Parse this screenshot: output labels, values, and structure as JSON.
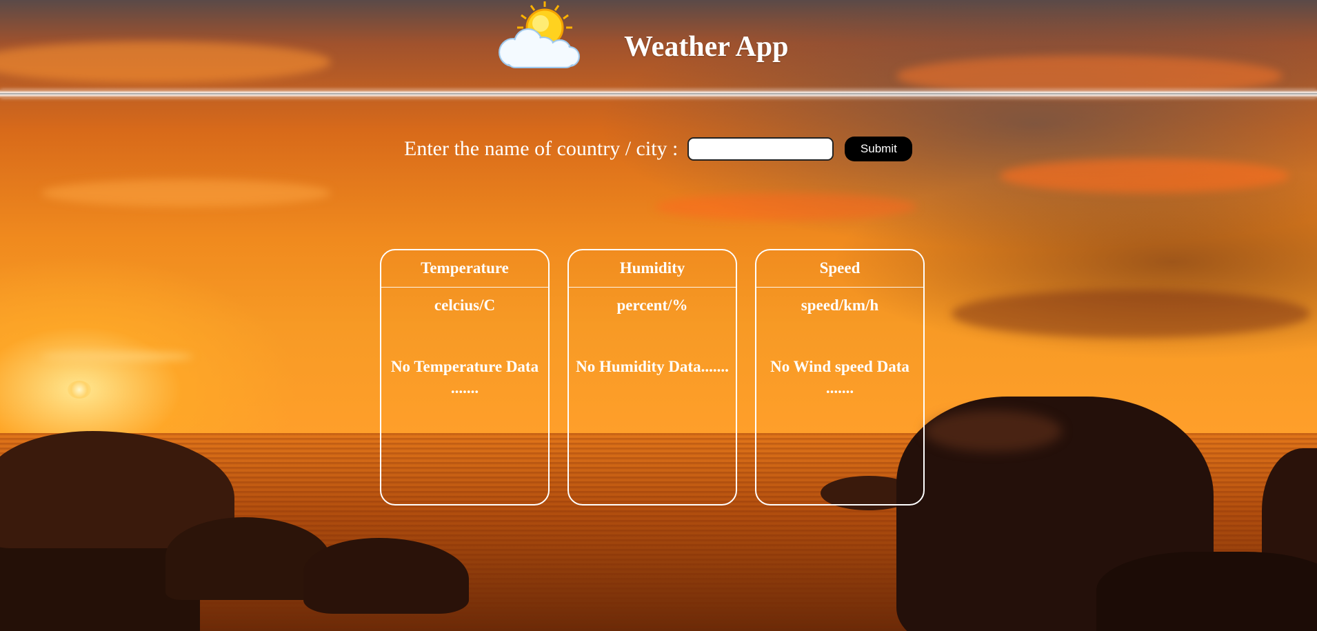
{
  "header": {
    "title": "Weather App",
    "logo_icon": "sun-behind-cloud-icon"
  },
  "search": {
    "label": "Enter the name of country / city :",
    "value": "",
    "placeholder": "",
    "submit_label": "Submit"
  },
  "cards": [
    {
      "title": "Temperature",
      "unit": "celcius/C",
      "value": "No Temperature Data ......."
    },
    {
      "title": "Humidity",
      "unit": "percent/%",
      "value": "No Humidity Data......."
    },
    {
      "title": "Speed",
      "unit": "speed/km/h",
      "value": "No Wind speed Data ......."
    }
  ],
  "colors": {
    "text": "#ffffff",
    "button_bg": "#000000",
    "card_border": "#ffffff"
  }
}
